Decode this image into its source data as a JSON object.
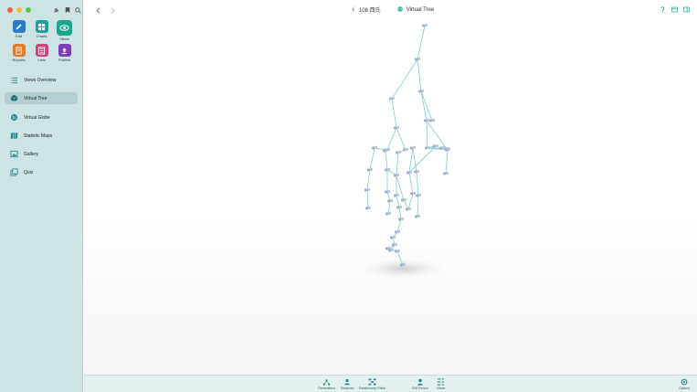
{
  "window": {
    "title_count": "108 西氏",
    "title_view": "Virtual Tree"
  },
  "sidebar": {
    "tiles": [
      {
        "label": "Edit",
        "color": "#2a7cc7",
        "icon": "pencil-icon"
      },
      {
        "label": "Charts",
        "color": "#17a19b",
        "icon": "chart-grid-icon"
      },
      {
        "label": "Views",
        "color": "#1aa88c",
        "icon": "eye-icon"
      },
      {
        "label": "Reports",
        "color": "#e07a2c",
        "icon": "report-icon"
      },
      {
        "label": "Lists",
        "color": "#d0417a",
        "icon": "list-icon"
      },
      {
        "label": "Publish",
        "color": "#7d3fb8",
        "icon": "publish-icon"
      }
    ],
    "nav": [
      {
        "label": "Views Overview",
        "icon": "views-overview-icon"
      },
      {
        "label": "Virtual Tree",
        "icon": "virtual-tree-icon"
      },
      {
        "label": "Virtual Globe",
        "icon": "globe-icon"
      },
      {
        "label": "Statistic Maps",
        "icon": "statistic-maps-icon"
      },
      {
        "label": "Gallery",
        "icon": "gallery-icon"
      },
      {
        "label": "Quiz",
        "icon": "quiz-icon"
      }
    ],
    "active_item": "Virtual Tree"
  },
  "bottombar": {
    "items": [
      {
        "label": "Generations",
        "icon": "generations-icon"
      },
      {
        "label": "Relatives",
        "icon": "relatives-icon"
      },
      {
        "label": "Relationship Paths",
        "icon": "relationship-paths-icon"
      },
      {
        "label": "Edit Person",
        "icon": "edit-person-icon"
      },
      {
        "label": "Views",
        "icon": "views-icon"
      }
    ],
    "options_label": "Options"
  },
  "colors": {
    "sidebar_bg": "#cde3e4",
    "accent": "#1aa88c",
    "node": "#9fb1c9",
    "edge": "#8fd0d8"
  }
}
